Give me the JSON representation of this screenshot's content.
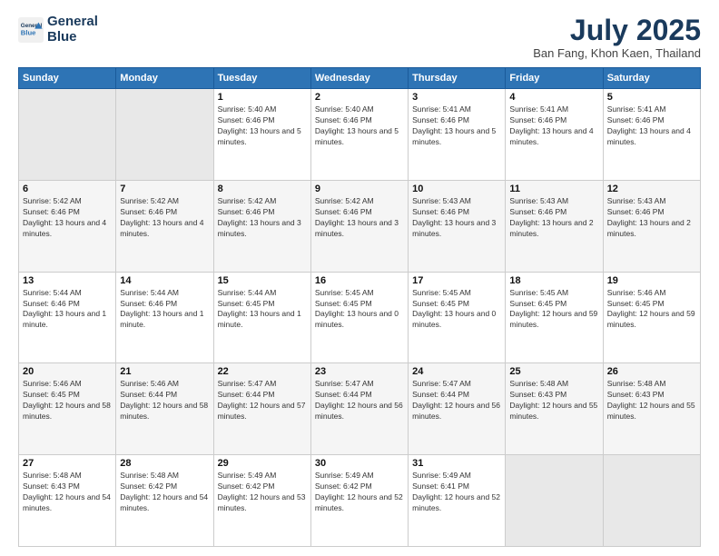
{
  "header": {
    "logo_line1": "General",
    "logo_line2": "Blue",
    "month": "July 2025",
    "location": "Ban Fang, Khon Kaen, Thailand"
  },
  "days_of_week": [
    "Sunday",
    "Monday",
    "Tuesday",
    "Wednesday",
    "Thursday",
    "Friday",
    "Saturday"
  ],
  "weeks": [
    [
      {
        "day": "",
        "info": ""
      },
      {
        "day": "",
        "info": ""
      },
      {
        "day": "1",
        "info": "Sunrise: 5:40 AM\nSunset: 6:46 PM\nDaylight: 13 hours and 5 minutes."
      },
      {
        "day": "2",
        "info": "Sunrise: 5:40 AM\nSunset: 6:46 PM\nDaylight: 13 hours and 5 minutes."
      },
      {
        "day": "3",
        "info": "Sunrise: 5:41 AM\nSunset: 6:46 PM\nDaylight: 13 hours and 5 minutes."
      },
      {
        "day": "4",
        "info": "Sunrise: 5:41 AM\nSunset: 6:46 PM\nDaylight: 13 hours and 4 minutes."
      },
      {
        "day": "5",
        "info": "Sunrise: 5:41 AM\nSunset: 6:46 PM\nDaylight: 13 hours and 4 minutes."
      }
    ],
    [
      {
        "day": "6",
        "info": "Sunrise: 5:42 AM\nSunset: 6:46 PM\nDaylight: 13 hours and 4 minutes."
      },
      {
        "day": "7",
        "info": "Sunrise: 5:42 AM\nSunset: 6:46 PM\nDaylight: 13 hours and 4 minutes."
      },
      {
        "day": "8",
        "info": "Sunrise: 5:42 AM\nSunset: 6:46 PM\nDaylight: 13 hours and 3 minutes."
      },
      {
        "day": "9",
        "info": "Sunrise: 5:42 AM\nSunset: 6:46 PM\nDaylight: 13 hours and 3 minutes."
      },
      {
        "day": "10",
        "info": "Sunrise: 5:43 AM\nSunset: 6:46 PM\nDaylight: 13 hours and 3 minutes."
      },
      {
        "day": "11",
        "info": "Sunrise: 5:43 AM\nSunset: 6:46 PM\nDaylight: 13 hours and 2 minutes."
      },
      {
        "day": "12",
        "info": "Sunrise: 5:43 AM\nSunset: 6:46 PM\nDaylight: 13 hours and 2 minutes."
      }
    ],
    [
      {
        "day": "13",
        "info": "Sunrise: 5:44 AM\nSunset: 6:46 PM\nDaylight: 13 hours and 1 minute."
      },
      {
        "day": "14",
        "info": "Sunrise: 5:44 AM\nSunset: 6:46 PM\nDaylight: 13 hours and 1 minute."
      },
      {
        "day": "15",
        "info": "Sunrise: 5:44 AM\nSunset: 6:45 PM\nDaylight: 13 hours and 1 minute."
      },
      {
        "day": "16",
        "info": "Sunrise: 5:45 AM\nSunset: 6:45 PM\nDaylight: 13 hours and 0 minutes."
      },
      {
        "day": "17",
        "info": "Sunrise: 5:45 AM\nSunset: 6:45 PM\nDaylight: 13 hours and 0 minutes."
      },
      {
        "day": "18",
        "info": "Sunrise: 5:45 AM\nSunset: 6:45 PM\nDaylight: 12 hours and 59 minutes."
      },
      {
        "day": "19",
        "info": "Sunrise: 5:46 AM\nSunset: 6:45 PM\nDaylight: 12 hours and 59 minutes."
      }
    ],
    [
      {
        "day": "20",
        "info": "Sunrise: 5:46 AM\nSunset: 6:45 PM\nDaylight: 12 hours and 58 minutes."
      },
      {
        "day": "21",
        "info": "Sunrise: 5:46 AM\nSunset: 6:44 PM\nDaylight: 12 hours and 58 minutes."
      },
      {
        "day": "22",
        "info": "Sunrise: 5:47 AM\nSunset: 6:44 PM\nDaylight: 12 hours and 57 minutes."
      },
      {
        "day": "23",
        "info": "Sunrise: 5:47 AM\nSunset: 6:44 PM\nDaylight: 12 hours and 56 minutes."
      },
      {
        "day": "24",
        "info": "Sunrise: 5:47 AM\nSunset: 6:44 PM\nDaylight: 12 hours and 56 minutes."
      },
      {
        "day": "25",
        "info": "Sunrise: 5:48 AM\nSunset: 6:43 PM\nDaylight: 12 hours and 55 minutes."
      },
      {
        "day": "26",
        "info": "Sunrise: 5:48 AM\nSunset: 6:43 PM\nDaylight: 12 hours and 55 minutes."
      }
    ],
    [
      {
        "day": "27",
        "info": "Sunrise: 5:48 AM\nSunset: 6:43 PM\nDaylight: 12 hours and 54 minutes."
      },
      {
        "day": "28",
        "info": "Sunrise: 5:48 AM\nSunset: 6:42 PM\nDaylight: 12 hours and 54 minutes."
      },
      {
        "day": "29",
        "info": "Sunrise: 5:49 AM\nSunset: 6:42 PM\nDaylight: 12 hours and 53 minutes."
      },
      {
        "day": "30",
        "info": "Sunrise: 5:49 AM\nSunset: 6:42 PM\nDaylight: 12 hours and 52 minutes."
      },
      {
        "day": "31",
        "info": "Sunrise: 5:49 AM\nSunset: 6:41 PM\nDaylight: 12 hours and 52 minutes."
      },
      {
        "day": "",
        "info": ""
      },
      {
        "day": "",
        "info": ""
      }
    ]
  ]
}
